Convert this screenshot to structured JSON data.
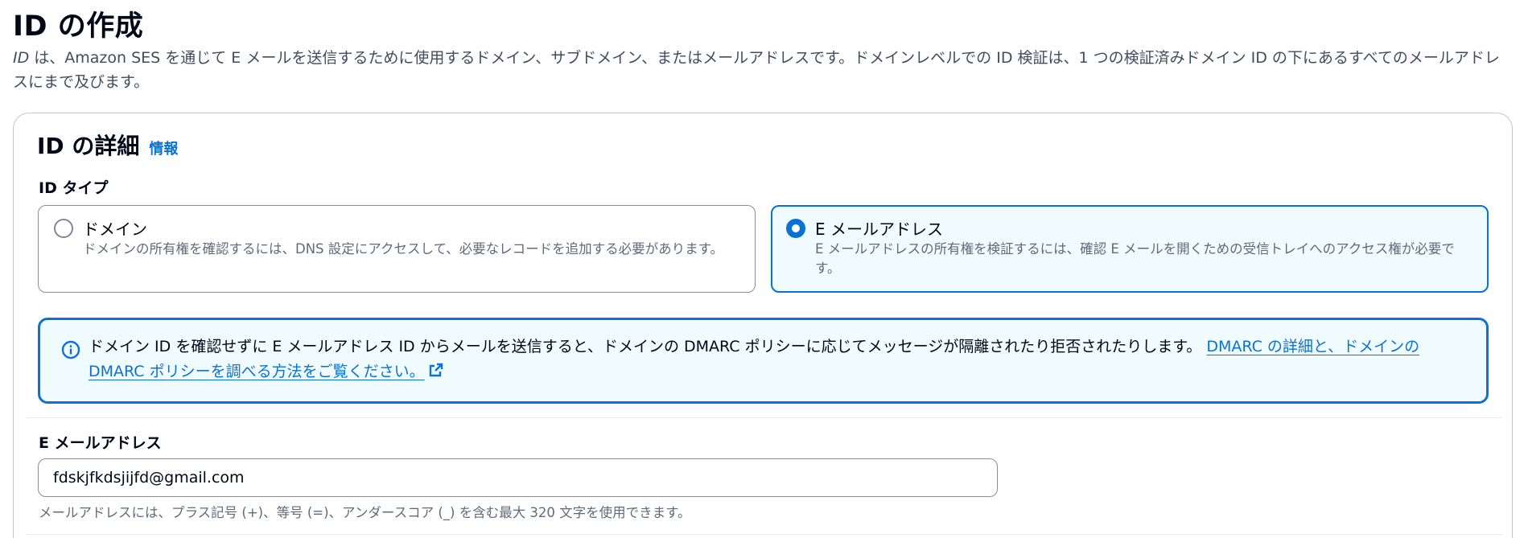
{
  "page": {
    "title": "ID の作成",
    "description_italic": "ID",
    "description_rest": " は、Amazon SES を通じて E メールを送信するために使用するドメイン、サブドメイン、またはメールアドレスです。ドメインレベルでの ID 検証は、1 つの検証済みドメイン ID の下にあるすべてのメールアドレスにまで及びます。"
  },
  "details": {
    "title": "ID の詳細",
    "info_link": "情報",
    "type_label": "ID タイプ",
    "options": [
      {
        "label": "ドメイン",
        "description": "ドメインの所有権を確認するには、DNS 設定にアクセスして、必要なレコードを追加する必要があります。",
        "selected": false
      },
      {
        "label": "E メールアドレス",
        "description": "E メールアドレスの所有権を検証するには、確認 E メールを開くための受信トレイへのアクセス権が必要です。",
        "selected": true
      }
    ]
  },
  "alert": {
    "icon": "info-circle-icon",
    "text": "ドメイン ID を確認せずに E メールアドレス ID からメールを送信すると、ドメインの DMARC ポリシーに応じてメッセージが隔離されたり拒否されたりします。 ",
    "link_text": "DMARC の詳細と、ドメインの DMARC ポリシーを調べる方法をご覧ください。",
    "link_icon": "external-link-icon"
  },
  "email": {
    "label": "E メールアドレス",
    "value": "fdskjfkdsjijfd@gmail.com",
    "hint": "メールアドレスには、プラス記号 (+)、等号 (=)、アンダースコア (_) を含む最大 320 文字を使用できます。"
  },
  "colors": {
    "accent": "#0972d3",
    "selected_bg": "#f0fbff",
    "text_primary": "#000716",
    "text_secondary": "#5f6b7a"
  }
}
